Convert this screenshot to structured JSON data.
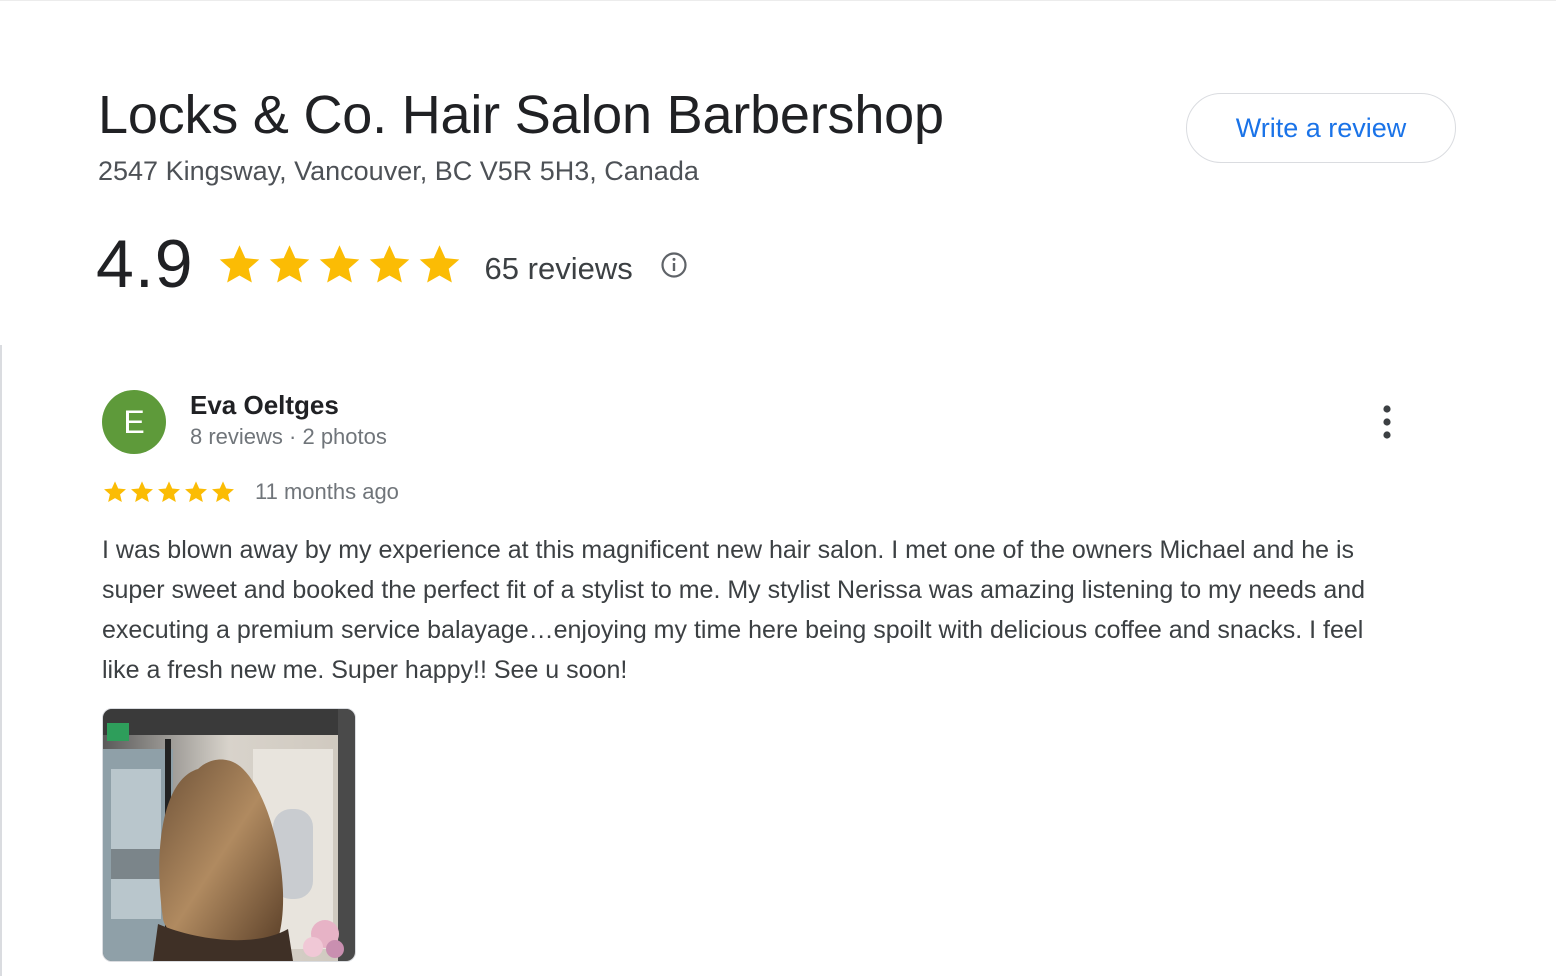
{
  "business": {
    "name": "Locks & Co. Hair Salon Barbershop",
    "address": "2547 Kingsway, Vancouver, BC V5R 5H3, Canada",
    "write_review_label": "Write a review"
  },
  "rating": {
    "value": "4.9",
    "stars": 5,
    "review_count": "65 reviews",
    "info_icon": "info-icon"
  },
  "review": {
    "avatar_letter": "E",
    "avatar_color": "#5e9a3a",
    "reviewer_name": "Eva Oeltges",
    "reviewer_meta": "8 reviews · 2 photos",
    "stars": 5,
    "date": "11 months ago",
    "text": "I was blown away by my experience at this magnificent new hair salon. I met one of the owners Michael and he is super sweet and booked the perfect fit of a stylist to me. My stylist Nerissa was amazing listening to my needs and executing a premium service balayage…enjoying my time here being spoilt with delicious coffee and snacks. I feel like a fresh new me. Super happy!! See u soon!",
    "more_icon": "more-vert-icon"
  },
  "colors": {
    "star": "#fbbc04",
    "link": "#1a73e8",
    "text_primary": "#202124",
    "text_secondary": "#70757a",
    "border": "#dadce0"
  }
}
